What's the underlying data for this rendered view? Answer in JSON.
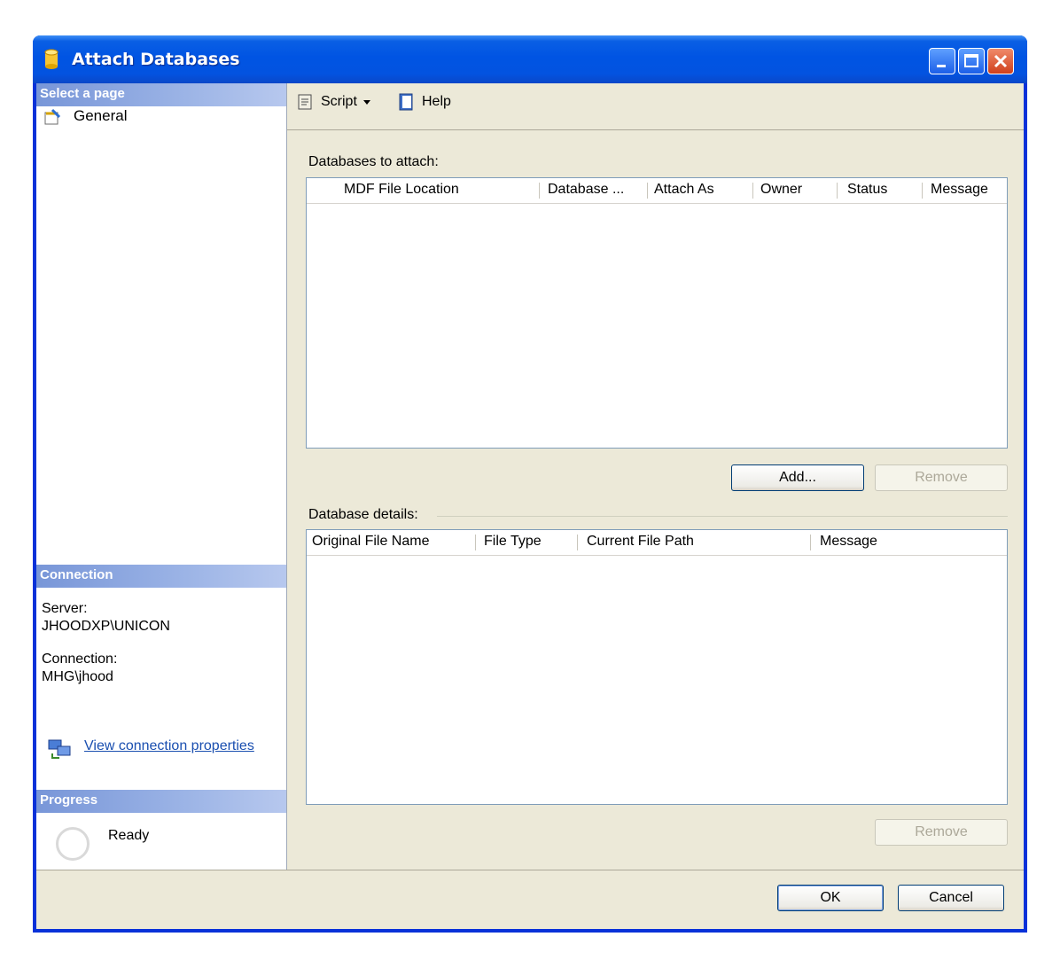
{
  "window": {
    "title": "Attach Databases",
    "title_color": "#0054e3",
    "buttons": [
      "minimize",
      "maximize",
      "close"
    ]
  },
  "left_panel": {
    "select_page_header": "Select a page",
    "pages": [
      {
        "label": "General",
        "icon": "general-page-icon"
      }
    ],
    "connection_header": "Connection",
    "server_label": "Server:",
    "server_value": "JHOODXP\\UNICON",
    "connection_label": "Connection:",
    "connection_value": "MHG\\jhood",
    "view_connection_link": "View connection properties",
    "progress_header": "Progress",
    "progress_status": "Ready"
  },
  "toolbar": {
    "script_label": "Script",
    "help_label": "Help"
  },
  "attach_grid": {
    "caption": "Databases to attach:",
    "columns": [
      "MDF File Location",
      "Database ...",
      "Attach As",
      "Owner",
      "Status",
      "Message"
    ]
  },
  "attach_buttons": {
    "add_label": "Add...",
    "remove_label": "Remove"
  },
  "details_grid": {
    "caption": "Database details:",
    "columns": [
      "Original File Name",
      "File Type",
      "Current File Path",
      "Message"
    ]
  },
  "details_buttons": {
    "remove_label": "Remove"
  },
  "footer": {
    "ok_label": "OK",
    "cancel_label": "Cancel"
  }
}
